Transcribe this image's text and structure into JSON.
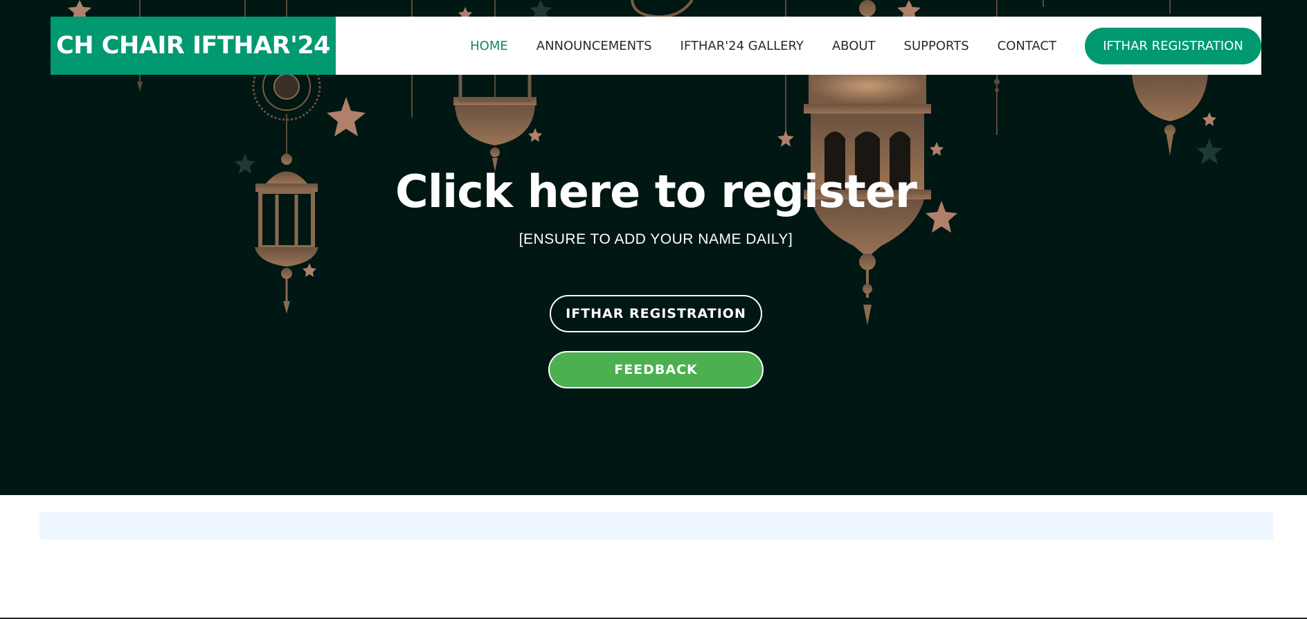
{
  "brand": {
    "title": "CH CHAIR IFTHAR'24",
    "color": "#009970"
  },
  "nav": {
    "items": [
      {
        "label": "HOME",
        "active": true
      },
      {
        "label": "ANNOUNCEMENTS",
        "active": false
      },
      {
        "label": "IFTHAR'24 GALLERY",
        "active": false
      },
      {
        "label": "ABOUT",
        "active": false
      },
      {
        "label": "SUPPORTS",
        "active": false
      },
      {
        "label": "CONTACT",
        "active": false
      }
    ],
    "cta_label": "IFTHAR REGISTRATION"
  },
  "hero": {
    "title": "Click here to register",
    "subtitle": "[ENSURE TO ADD YOUR NAME DAILY]",
    "register_button": "IFTHAR REGISTRATION",
    "feedback_button": "FEEDBACK",
    "background_color": "#001713",
    "accent_green": "#4caf50",
    "decoration_icons": [
      "lantern-icon",
      "star-icon",
      "mandala-icon",
      "crescent-icon"
    ]
  }
}
